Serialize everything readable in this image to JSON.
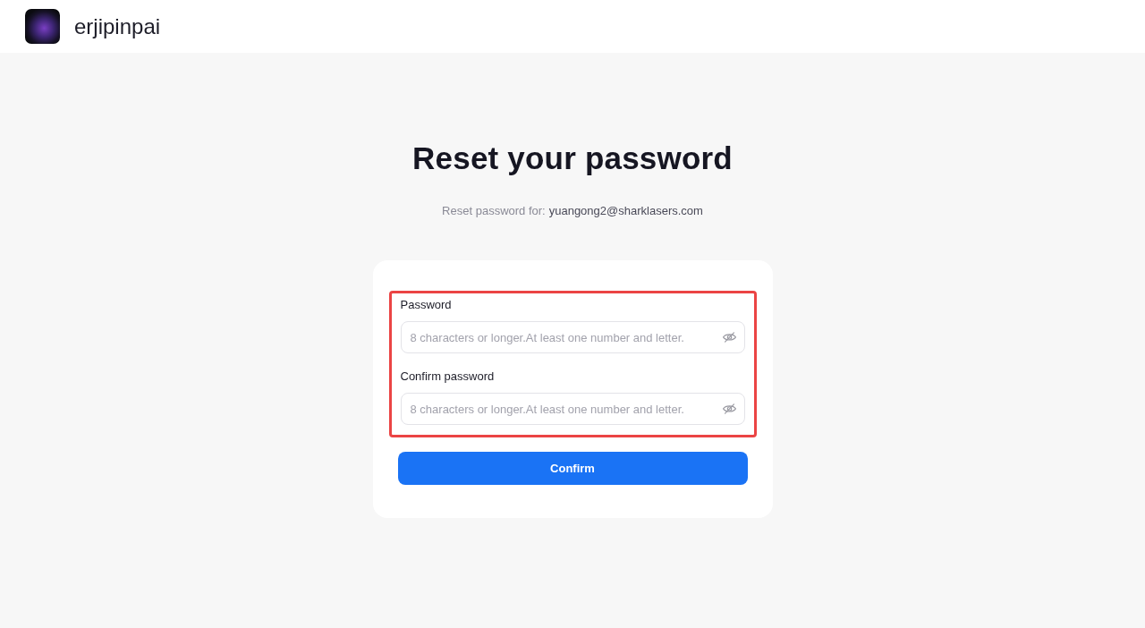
{
  "header": {
    "brand": "erjipinpai"
  },
  "page": {
    "title": "Reset your password",
    "subtitle": {
      "label": "Reset password for:",
      "email": "yuangong2@sharklasers.com"
    }
  },
  "form": {
    "highlighted": true,
    "fields": [
      {
        "label": "Password",
        "placeholder": "8 characters or longer.At least one number and letter.",
        "revealed": false
      },
      {
        "label": "Confirm password",
        "placeholder": "8 characters or longer.At least one number and letter.",
        "revealed": false
      }
    ],
    "submit": "Confirm"
  }
}
